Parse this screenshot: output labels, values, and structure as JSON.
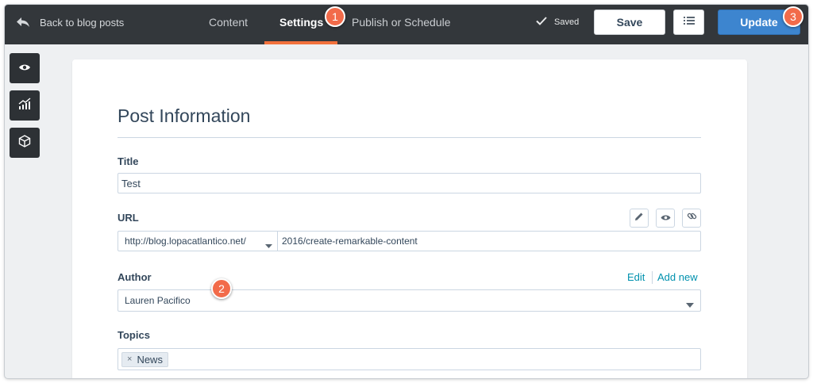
{
  "topbar": {
    "back_label": "Back to blog posts",
    "tabs": [
      {
        "label": "Content",
        "active": false
      },
      {
        "label": "Settings",
        "active": true
      },
      {
        "label": "Publish or Schedule",
        "active": false
      }
    ],
    "saved_label": "Saved",
    "save_label": "Save",
    "update_label": "Update",
    "accent_color": "#f2713c",
    "update_color": "#3d85cf"
  },
  "callouts": [
    "1",
    "2",
    "3"
  ],
  "rail": {
    "icons": [
      "eye-icon",
      "analytics-icon",
      "module-cube-icon"
    ]
  },
  "form": {
    "heading": "Post Information",
    "title": {
      "label": "Title",
      "value": "Test"
    },
    "url": {
      "label": "URL",
      "domain": "http://blog.lopacatlantico.net/",
      "slug": "2016/create-remarkable-content",
      "icons": [
        "pencil-icon",
        "eye-icon",
        "link-icon"
      ]
    },
    "author": {
      "label": "Author",
      "value": "Lauren Pacifico",
      "edit_label": "Edit",
      "add_new_label": "Add new"
    },
    "topics": {
      "label": "Topics",
      "tags": [
        "News"
      ],
      "remove_glyph": "×"
    }
  }
}
